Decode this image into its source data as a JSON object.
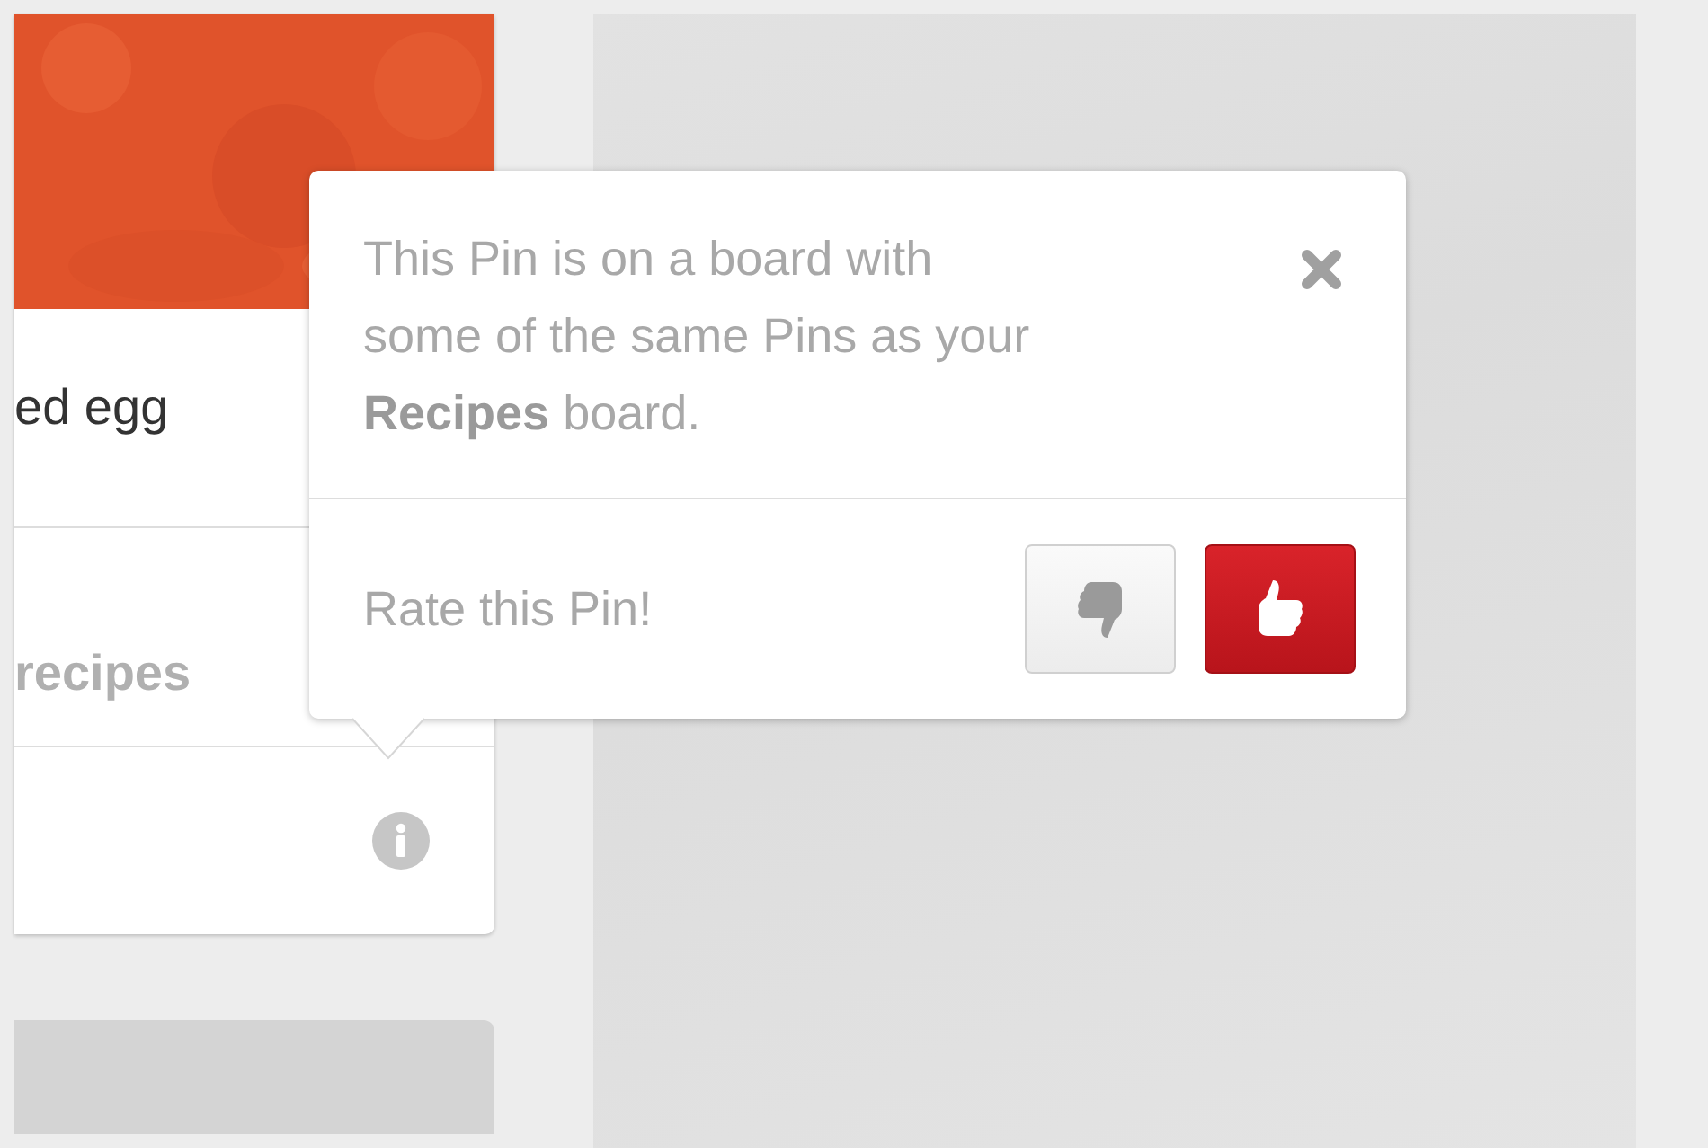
{
  "pin_card": {
    "title": "ed egg",
    "board": "recipes"
  },
  "popover": {
    "message": "This Pin is on a board with some of the same Pins as your **Recipes** board.",
    "rating_prompt": "Rate this Pin!",
    "buttons": [
      {
        "kind": "dislike",
        "selected": false
      },
      {
        "kind": "like",
        "selected": true
      }
    ]
  }
}
